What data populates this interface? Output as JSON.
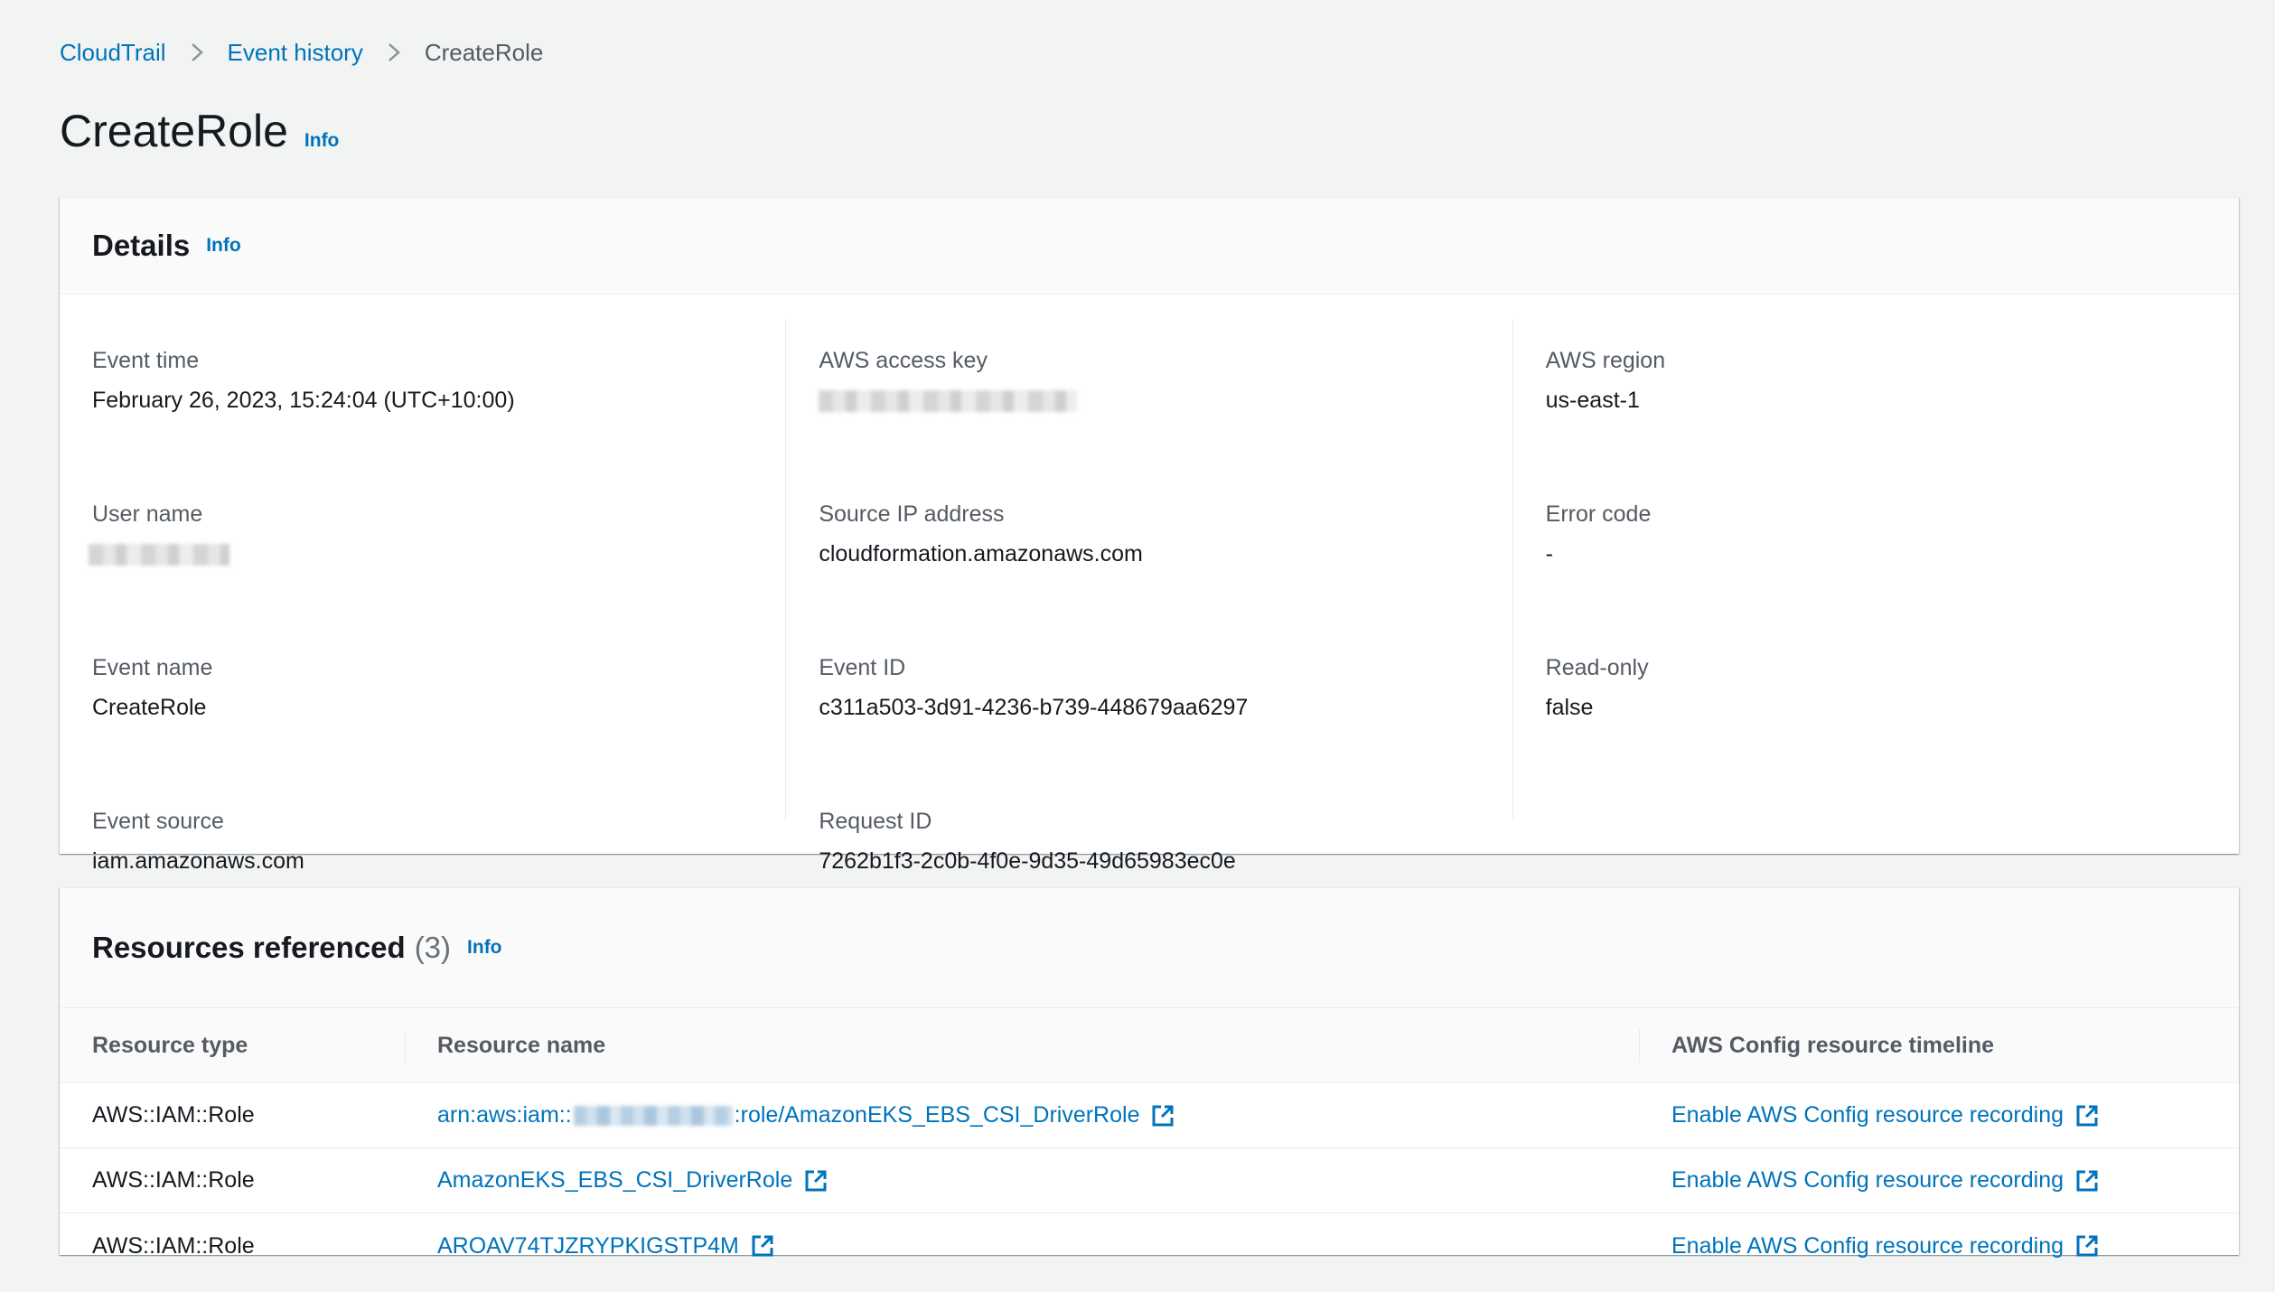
{
  "breadcrumb": {
    "items": [
      "CloudTrail",
      "Event history"
    ],
    "current": "CreateRole"
  },
  "page": {
    "title": "CreateRole",
    "info": "Info"
  },
  "details": {
    "title": "Details",
    "info": "Info",
    "columns": [
      [
        {
          "label": "Event time",
          "value": "February 26, 2023, 15:24:04 (UTC+10:00)"
        },
        {
          "label": "User name",
          "value": null,
          "redacted": true
        },
        {
          "label": "Event name",
          "value": "CreateRole"
        },
        {
          "label": "Event source",
          "value": "iam.amazonaws.com"
        }
      ],
      [
        {
          "label": "AWS access key",
          "value": null,
          "redacted": true
        },
        {
          "label": "Source IP address",
          "value": "cloudformation.amazonaws.com"
        },
        {
          "label": "Event ID",
          "value": "c311a503-3d91-4236-b739-448679aa6297"
        },
        {
          "label": "Request ID",
          "value": "7262b1f3-2c0b-4f0e-9d35-49d65983ec0e"
        }
      ],
      [
        {
          "label": "AWS region",
          "value": "us-east-1"
        },
        {
          "label": "Error code",
          "value": "-"
        },
        {
          "label": "Read-only",
          "value": "false"
        }
      ]
    ]
  },
  "resources": {
    "title": "Resources referenced",
    "count": "(3)",
    "info": "Info",
    "headers": {
      "type": "Resource type",
      "name": "Resource name",
      "timeline": "AWS Config resource timeline"
    },
    "rows": [
      {
        "type": "AWS::IAM::Role",
        "name_prefix": "arn:aws:iam::",
        "name_suffix": ":role/AmazonEKS_EBS_CSI_DriverRole",
        "timeline": "Enable AWS Config resource recording"
      },
      {
        "type": "AWS::IAM::Role",
        "name": "AmazonEKS_EBS_CSI_DriverRole",
        "timeline": "Enable AWS Config resource recording"
      },
      {
        "type": "AWS::IAM::Role",
        "name": "AROAV74TJZRYPKIGSTP4M",
        "timeline": "Enable AWS Config resource recording"
      }
    ]
  },
  "colors": {
    "link": "#0073bb",
    "background": "#f2f3f3",
    "text": "#16191f",
    "label": "#545b64"
  },
  "icons": {
    "breadcrumb_separator": "chevron-right-icon",
    "external_link": "external-link-icon"
  }
}
